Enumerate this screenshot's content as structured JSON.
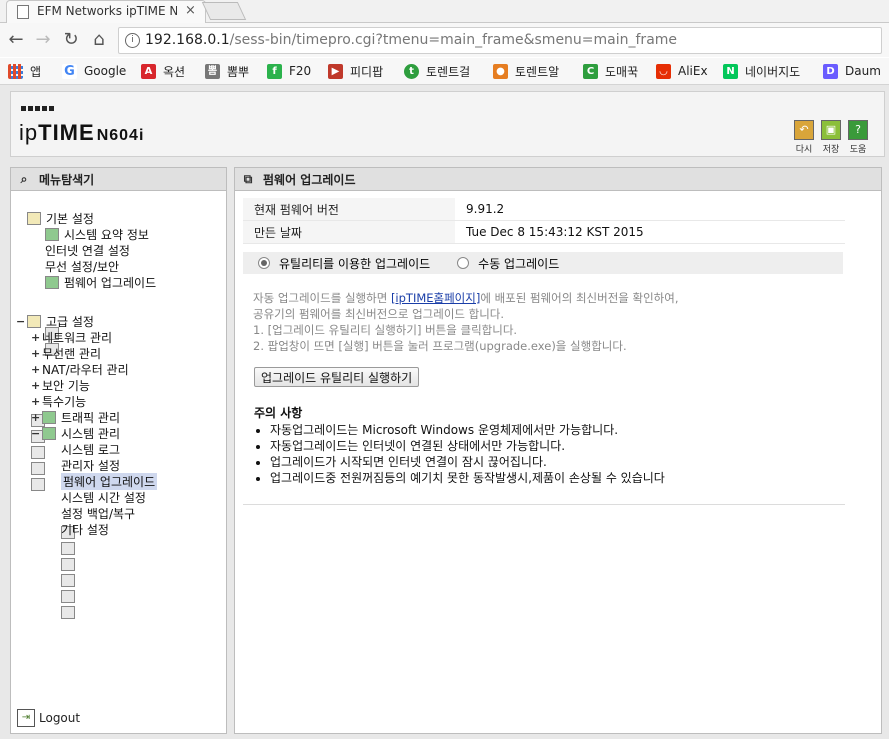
{
  "browser": {
    "tab_title": "EFM Networks ipTIME N",
    "url_host": "192.168.0.1",
    "url_path": "/sess-bin/timepro.cgi?tmenu=main_frame&smenu=main_frame",
    "bookmarks": [
      {
        "label": "앱",
        "icon": "apps-grid-icon",
        "color": "#e04a2a"
      },
      {
        "label": "Google",
        "icon": "google-icon",
        "color": "#4285f4"
      },
      {
        "label": "옥션",
        "icon": "auction-icon",
        "color": "#d8262c"
      },
      {
        "label": "뽐뿌",
        "icon": "ppomppu-icon",
        "color": "#666666"
      },
      {
        "label": "F20",
        "icon": "f20-icon",
        "color": "#2bb24c"
      },
      {
        "label": "피디팝",
        "icon": "pdpop-icon",
        "color": "#c0392b"
      },
      {
        "label": "토렌트걸",
        "icon": "torrentgirl-icon",
        "color": "#2e9e3e"
      },
      {
        "label": "토렌트알",
        "icon": "torrental-icon",
        "color": "#e67e22"
      },
      {
        "label": "도매꾹",
        "icon": "domeggook-icon",
        "color": "#2e9e3e"
      },
      {
        "label": "AliEx",
        "icon": "aliexpress-icon",
        "color": "#e62e04"
      },
      {
        "label": "네이버지도",
        "icon": "naver-icon",
        "color": "#03c75a"
      },
      {
        "label": "Daum",
        "icon": "daum-icon",
        "color": "#6a5cff"
      }
    ]
  },
  "header": {
    "brand_ip": "ip",
    "brand_time": "TIME",
    "model": "N604i",
    "buttons": [
      {
        "label": "다시",
        "icon": "refresh-icon",
        "color": "#d9a53a"
      },
      {
        "label": "저장",
        "icon": "save-icon",
        "color": "#8bbf3a"
      },
      {
        "label": "도움",
        "icon": "help-icon",
        "color": "#3a9a3a"
      }
    ]
  },
  "left_panel": {
    "title": "메뉴탐색기",
    "basic": {
      "label": "기본 설정",
      "items": [
        "시스템 요약 정보",
        "인터넷 연결 설정",
        "무선 설정/보안",
        "펌웨어 업그레이드"
      ]
    },
    "advanced": {
      "toggle": "−",
      "label": "고급 설정",
      "groups": [
        {
          "toggle": "+",
          "label": "네트워크 관리"
        },
        {
          "toggle": "+",
          "label": "무선랜 관리"
        },
        {
          "toggle": "+",
          "label": "NAT/라우터 관리"
        },
        {
          "toggle": "+",
          "label": "보안 기능"
        },
        {
          "toggle": "+",
          "label": "특수기능"
        },
        {
          "toggle": "+",
          "label": "트래픽 관리"
        },
        {
          "toggle": "−",
          "label": "시스템 관리"
        }
      ],
      "system_items": [
        "시스템 로그",
        "관리자 설정",
        "펌웨어 업그레이드",
        "시스템 시간 설정",
        "설정 백업/복구",
        "기타 설정"
      ],
      "selected_item": "펌웨어 업그레이드"
    },
    "logout": "Logout"
  },
  "main": {
    "title": "펌웨어 업그레이드",
    "info_rows": [
      {
        "key": "현재 펌웨어 버전",
        "value": "9.91.2"
      },
      {
        "key": "만든 날짜",
        "value": "Tue Dec 8 15:43:12 KST 2015"
      }
    ],
    "radios": [
      {
        "label": "유틸리티를 이용한 업그레이드",
        "checked": true
      },
      {
        "label": "수동 업그레이드",
        "checked": false
      }
    ],
    "desc": {
      "line1_pre": "자동 업그레이드를 실행하면 ",
      "line1_link": "[ipTIME홈페이지]",
      "line1_post": "에 배포된 펌웨어의 최신버전을 확인하여,",
      "line2": "공유기의 펌웨어를 최신버전으로 업그레이드 합니다.",
      "line3": "1. [업그레이드 유틸리티 실행하기] 버튼을 클릭합니다.",
      "line4": "2. 팝업창이 뜨면 [실행] 버튼을 눌러 프로그램(upgrade.exe)을 실행합니다."
    },
    "button": "업그레이드 유틸리티 실행하기",
    "notice_title": "주의 사항",
    "notices": [
      "자동업그레이드는 Microsoft Windows 운영체제에서만 가능합니다.",
      "자동업그레이드는 인터넷이 연결된 상태에서만 가능합니다.",
      "업그레이드가 시작되면 인터넷 연결이 잠시 끊어집니다.",
      "업그레이드중 전원꺼짐등의 예기치 못한 동작발생시,제품이 손상될 수 있습니다"
    ]
  }
}
